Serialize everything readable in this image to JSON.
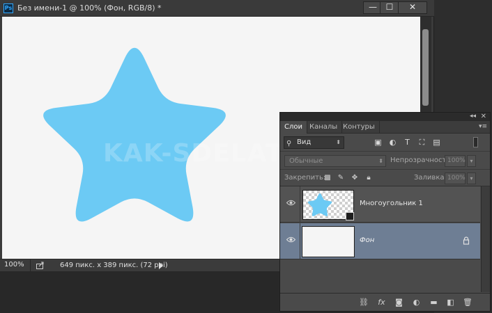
{
  "window": {
    "app_icon": "Ps",
    "title": "Без имени-1 @ 100% (Фон, RGB/8) *",
    "minimize_icon": "—",
    "maximize_icon": "☐",
    "close_icon": "✕"
  },
  "canvas": {
    "background": "#f5f5f5",
    "shape_color": "#6ccaf4",
    "shape": "rounded-star"
  },
  "statusbar": {
    "zoom": "100%",
    "doc_info": "649 пикс. x 389 пикс. (72 ppi)"
  },
  "watermark": "KAK-SDELAT.ORG",
  "layers_panel": {
    "collapse_icon": "◂◂",
    "close_icon": "✕",
    "menu_icon": "▾≡",
    "tabs": [
      {
        "label": "Слои",
        "active": true
      },
      {
        "label": "Каналы",
        "active": false
      },
      {
        "label": "Контуры",
        "active": false
      }
    ],
    "filter_kind": "Вид",
    "blend_mode": "Обычные",
    "opacity_label": "Непрозрачность:",
    "opacity_value": "100%",
    "lock_label": "Закрепить:",
    "fill_label": "Заливка:",
    "fill_value": "100%",
    "layers": [
      {
        "name": "Многоугольник 1",
        "visible": true,
        "selected": false,
        "locked": false
      },
      {
        "name": "Фон",
        "visible": true,
        "selected": true,
        "locked": true
      }
    ],
    "selected_row_color": "#6e7e94"
  }
}
